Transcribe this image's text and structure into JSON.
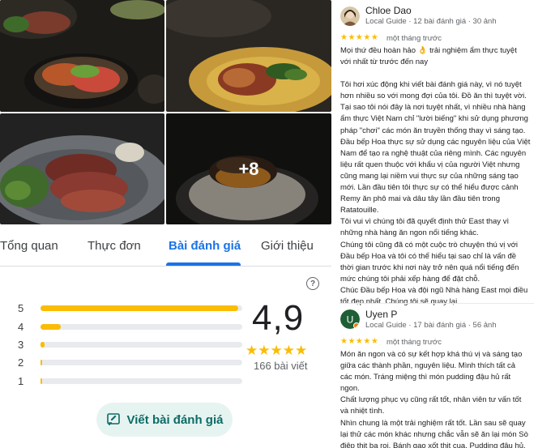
{
  "photos": {
    "more_label": "+8"
  },
  "tabs": [
    {
      "label": "Tổng quan",
      "active": false
    },
    {
      "label": "Thực đơn",
      "active": false
    },
    {
      "label": "Bài đánh giá",
      "active": true
    },
    {
      "label": "Giới thiệu",
      "active": false
    }
  ],
  "rating_summary": {
    "score": "4,9",
    "stars": "★★★★★",
    "count_label": "166 bài viết",
    "help_icon": "?",
    "histogram": [
      {
        "label": "5",
        "fraction": 0.98
      },
      {
        "label": "4",
        "fraction": 0.1
      },
      {
        "label": "3",
        "fraction": 0.02
      },
      {
        "label": "2",
        "fraction": 0.01
      },
      {
        "label": "1",
        "fraction": 0.01
      }
    ]
  },
  "write_review": {
    "label": "Viết bài đánh giá",
    "icon": "edit-review-icon"
  },
  "reviews": [
    {
      "name": "Chloe Dao",
      "meta": "Local Guide · 12 bài đánh giá · 30 ảnh",
      "stars": "★★★★★",
      "time": "một tháng trước",
      "lines": [
        "Mọi thứ đều hoàn hảo 👌 trải nghiệm ẩm thực tuyệt",
        "với nhất từ trước đến nay",
        "",
        "Tôi hơi xúc động khi viết bài đánh giá này, vì nó tuyệt",
        "hơn nhiều so với mong đợi của tôi. Đồ ăn thì tuyệt vời.",
        "Tại sao tôi nói đây là nơi tuyệt nhất, vì nhiều nhà hàng",
        "ẩm thực Việt Nam chỉ \"lười biếng\" khi sử dụng phương",
        "pháp \"chơi\" các món ăn truyền thống thay vì sáng tạo.",
        "Đầu bếp Hoa thực sự sử dụng các nguyên liệu của Việt",
        "Nam để tạo ra nghệ thuật của riêng mình. Các nguyên",
        "liệu rất quen thuộc với khẩu vị của người Việt nhưng",
        "cũng mang lại niềm vui thực sự của những sáng tạo",
        "mới. Lần đầu tiên tôi thực sự có thể hiểu được cảnh",
        "Remy ăn phô mai và dâu tây lần đầu tiên trong",
        "Ratatouille.",
        "Tôi vui vì chúng tôi đã quyết định thử East thay vì",
        "những nhà hàng ăn ngon nổi tiếng khác.",
        "Chúng tôi cũng đã có một cuộc trò chuyện thú vị với",
        "Đầu bếp Hoa và tôi có thể hiểu tại sao chỉ là vấn đề",
        "thời gian trước khi nơi này trở nên quá nổi tiếng đến",
        "mức chúng tôi phải xếp hàng để đặt chỗ.",
        "Chúc Đầu bếp Hoa và đội ngũ Nhà hàng East mọi điều",
        "tốt đẹp nhất. Chúng tôi sẽ quay lại."
      ]
    },
    {
      "name": "Uyen P",
      "avatar_letter": "U",
      "meta": "Local Guide · 17 bài đánh giá · 56 ảnh",
      "stars": "★★★★★",
      "time": "một tháng trước",
      "lines": [
        "Món ăn ngon và có sự kết hợp khá thú vị và sáng tạo",
        "giữa các thành phần, nguyên liệu. Mình thích tất cả",
        "các món. Tráng miệng thì món pudding đậu hủ rất",
        "ngon.",
        "Chất lượng phục vụ cũng rất tốt, nhân viên tư vấn tốt",
        "và nhiệt tình.",
        "Nhìn chung là một trải nghiệm rất tốt. Lần sau sẽ quay",
        "lại thử các món khác nhưng chắc vẫn sẽ ăn lại món Sò",
        "điệp thịt ba rọi, Bánh gạo xốt thịt cua, Pudding đậu hủ."
      ]
    }
  ]
}
